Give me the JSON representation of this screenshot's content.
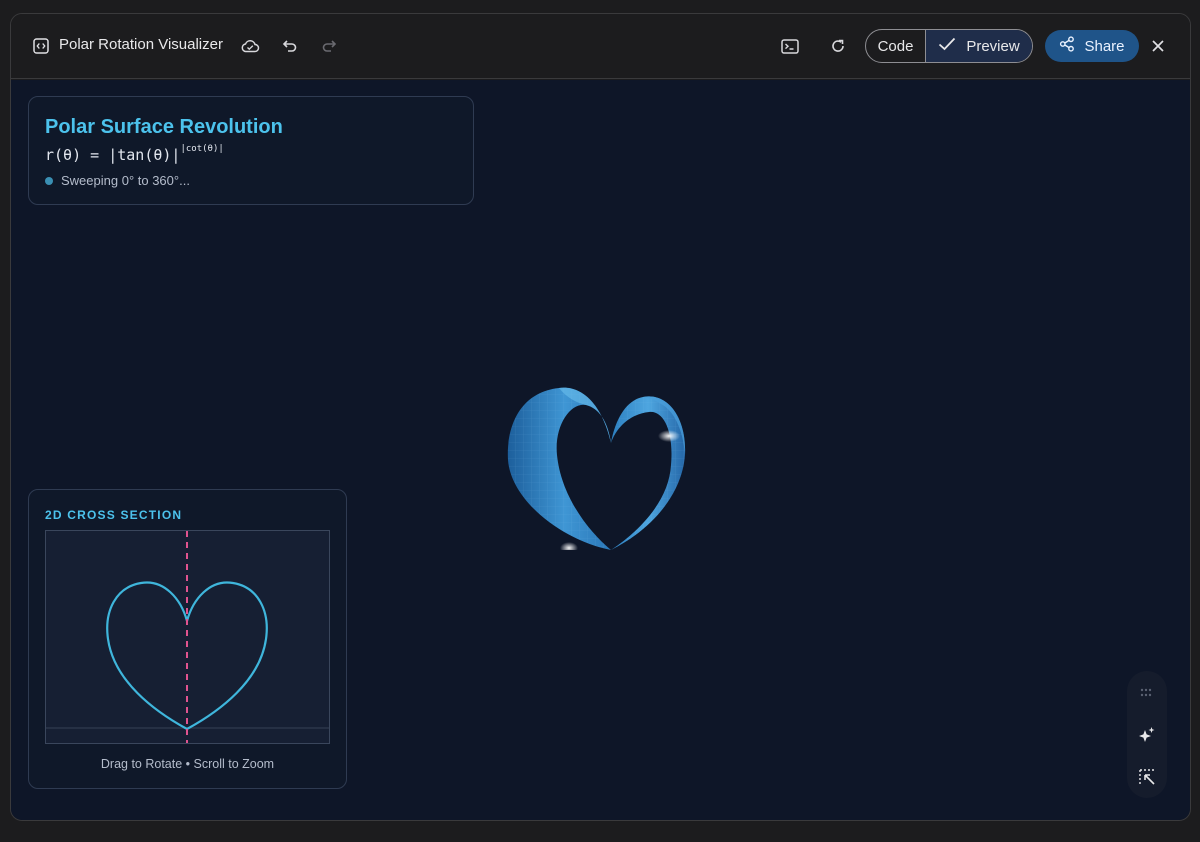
{
  "window": {
    "title": "Polar Rotation Visualizer",
    "icons": [
      "code-icon",
      "cloud-save-icon",
      "undo-icon",
      "redo-icon",
      "terminal-icon",
      "refresh-icon",
      "share-icon",
      "close-icon"
    ],
    "toggle": {
      "code_label": "Code",
      "preview_label": "Preview",
      "selected": "Preview"
    },
    "share_label": "Share"
  },
  "info_card": {
    "title": "Polar Surface Revolution",
    "formula_main": "r(θ) = |tan(θ)|",
    "formula_exponent": "|cot(θ)|",
    "status": "Sweeping 0° to 360°..."
  },
  "cross_section": {
    "title": "2D CROSS SECTION",
    "hint": "Drag to Rotate • Scroll to Zoom"
  },
  "side_toolbar": {
    "icons": [
      "grid-handle-icon",
      "sparkle-icon",
      "select-element-icon"
    ]
  },
  "colors": {
    "accent": "#4cc2ec",
    "stage_bg": "#0e1628",
    "share_bg": "#1f5489",
    "axis_dash": "#e0538f"
  }
}
